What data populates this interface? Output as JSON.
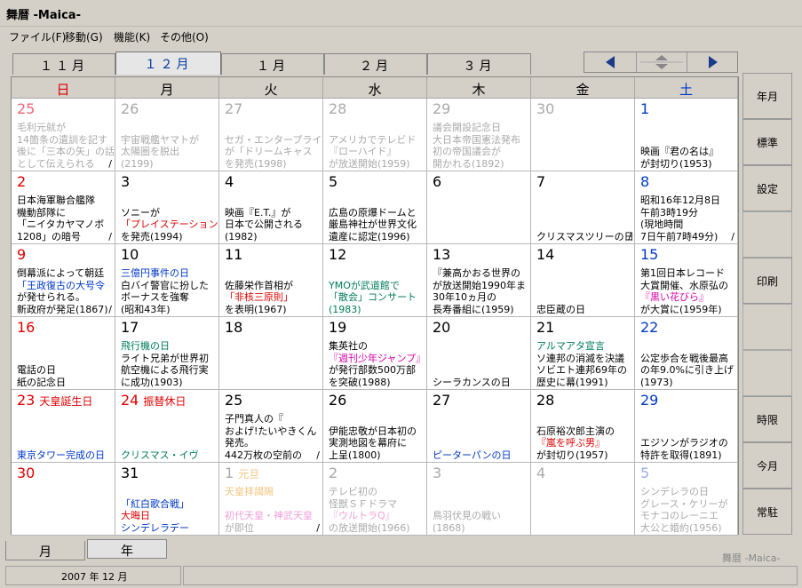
{
  "window": {
    "title": "舞暦 -Maica-",
    "brand": "舞暦 -Maica-"
  },
  "menu": [
    "ファイル(F)",
    "移動(G)",
    "機能(K)",
    "その他(O)"
  ],
  "month_tabs": [
    {
      "label": "１１月",
      "active": false
    },
    {
      "label": "１２月",
      "active": true
    },
    {
      "label": "１月",
      "active": false
    },
    {
      "label": "２月",
      "active": false
    },
    {
      "label": "３月",
      "active": false
    }
  ],
  "nav": {
    "prev": "◀",
    "updown": "⇕",
    "next": "▶"
  },
  "weekdays": [
    {
      "label": "日",
      "color": "#e00000"
    },
    {
      "label": "月",
      "color": "#000000"
    },
    {
      "label": "火",
      "color": "#000000"
    },
    {
      "label": "水",
      "color": "#000000"
    },
    {
      "label": "木",
      "color": "#000000"
    },
    {
      "label": "金",
      "color": "#000000"
    },
    {
      "label": "土",
      "color": "#0039c8"
    }
  ],
  "weeks": [
    [
      {
        "day": "25",
        "nc": "pinkred",
        "tone": "grey",
        "lines": [
          {
            "t": "毛利元就が"
          },
          {
            "t": "14箇条の遺訓を記す"
          },
          {
            "t": "後に「三本の矢」の話"
          },
          {
            "t": "として伝えられる"
          }
        ],
        "slash": true
      },
      {
        "day": "26",
        "nc": "grey",
        "tone": "grey",
        "lines": [
          {
            "t": "宇宙戦艦ヤマトが"
          },
          {
            "t": "太陽圏を脱出"
          },
          {
            "t": "(2199)"
          }
        ]
      },
      {
        "day": "27",
        "nc": "grey",
        "tone": "grey",
        "lines": [
          {
            "t": "セガ・エンタープライ"
          },
          {
            "t": "が「ドリームキャス"
          },
          {
            "t": "を発売(1998)"
          }
        ]
      },
      {
        "day": "28",
        "nc": "grey",
        "tone": "grey",
        "lines": [
          {
            "t": "アメリカでテレビド"
          },
          {
            "t": "『ローハイド』"
          },
          {
            "t": "が放送開始(1959)"
          }
        ]
      },
      {
        "day": "29",
        "nc": "grey",
        "tone": "grey",
        "lines": [
          {
            "t": "議会開設記念日"
          },
          {
            "t": "大日本帝国憲法発布"
          },
          {
            "t": "初の帝国議会が"
          },
          {
            "t": "開かれる(1892)"
          }
        ]
      },
      {
        "day": "30",
        "nc": "grey",
        "tone": "grey",
        "lines": []
      },
      {
        "day": "1",
        "nc": "blue",
        "lines": [
          {
            "t": "映画『君の名は』"
          },
          {
            "t": "が封切り(1953)"
          }
        ]
      }
    ],
    [
      {
        "day": "2",
        "nc": "red",
        "lines": [
          {
            "t": "日本海軍聯合艦隊"
          },
          {
            "t": "機動部隊に"
          },
          {
            "t": "「ニイタカヤマノボ"
          },
          {
            "t": "1208」の暗号"
          }
        ],
        "slash": true
      },
      {
        "day": "3",
        "lines": [
          {
            "t": "ソニーが"
          },
          {
            "t": "「プレイステーション",
            "c": "red"
          },
          {
            "t": "を発売(1994)"
          }
        ]
      },
      {
        "day": "4",
        "lines": [
          {
            "t": "映画『E.T.』が"
          },
          {
            "t": "日本で公開される"
          },
          {
            "t": "(1982)"
          }
        ]
      },
      {
        "day": "5",
        "lines": [
          {
            "t": "広島の原爆ドームと"
          },
          {
            "t": "厳島神社が世界文化"
          },
          {
            "t": "遺産に認定(1996)"
          }
        ]
      },
      {
        "day": "6",
        "lines": []
      },
      {
        "day": "7",
        "lines": [
          {
            "t": "クリスマスツリーの日"
          }
        ],
        "slash": true
      },
      {
        "day": "8",
        "nc": "blue",
        "lines": [
          {
            "t": "昭和16年12月8日"
          },
          {
            "t": "午前3時19分"
          },
          {
            "t": "(現地時間"
          },
          {
            "t": "7日午前7時49分)"
          }
        ],
        "slash": true
      }
    ],
    [
      {
        "day": "9",
        "nc": "red",
        "lines": [
          {
            "t": "倒幕派によって朝廷"
          },
          {
            "t": "「王政復古の大号令",
            "c": "blue"
          },
          {
            "t": "が発せられる。"
          },
          {
            "t": "新政府が発足(1867)"
          }
        ],
        "slash": true
      },
      {
        "day": "10",
        "lines": [
          {
            "t": "三億円事件の日",
            "c": "blue"
          },
          {
            "t": "白バイ警官に扮した"
          },
          {
            "t": "ボーナスを強奪"
          },
          {
            "t": "(昭和43年)"
          }
        ]
      },
      {
        "day": "11",
        "lines": [
          {
            "t": "佐藤栄作首相が"
          },
          {
            "t": "「非核三原則」",
            "c": "red"
          },
          {
            "t": "を表明(1967)"
          }
        ]
      },
      {
        "day": "12",
        "lines": [
          {
            "t": "YMOが武道館で",
            "c": "green"
          },
          {
            "t": "「散会」コンサート",
            "c": "green"
          },
          {
            "t": "(1983)",
            "c": "green"
          }
        ]
      },
      {
        "day": "13",
        "lines": [
          {
            "t": "『兼高かおる世界の"
          },
          {
            "t": "が放送開始1990年ま"
          },
          {
            "t": "30年10ヵ月の"
          },
          {
            "t": "長寿番組に(1959)"
          }
        ]
      },
      {
        "day": "14",
        "lines": [
          {
            "t": "忠臣蔵の日"
          }
        ]
      },
      {
        "day": "15",
        "nc": "blue",
        "lines": [
          {
            "t": "第1回日本レコード"
          },
          {
            "t": "大賞開催、水原弘の"
          },
          {
            "t": "『黒い花びら』",
            "c": "mag"
          },
          {
            "t": "が大賞に(1959年)"
          }
        ]
      }
    ],
    [
      {
        "day": "16",
        "nc": "red",
        "lines": [
          {
            "t": "電話の日"
          },
          {
            "t": "紙の記念日"
          }
        ]
      },
      {
        "day": "17",
        "lines": [
          {
            "t": "飛行機の日",
            "c": "green"
          },
          {
            "t": "ライト兄弟が世界初"
          },
          {
            "t": "航空機による飛行実"
          },
          {
            "t": "に成功(1903)"
          }
        ]
      },
      {
        "day": "18",
        "lines": []
      },
      {
        "day": "19",
        "lines": [
          {
            "t": "集英社の"
          },
          {
            "t": "『週刊少年ジャンプ』",
            "c": "mag"
          },
          {
            "t": "が発行部数500万部"
          },
          {
            "t": "を突破(1988)"
          }
        ]
      },
      {
        "day": "20",
        "lines": [
          {
            "t": "シーラカンスの日"
          }
        ]
      },
      {
        "day": "21",
        "lines": [
          {
            "t": "アルマアタ宣言",
            "c": "green"
          },
          {
            "t": "ソ連邦の消滅を決議"
          },
          {
            "t": "ソビエト連邦69年の"
          },
          {
            "t": "歴史に幕(1991)"
          }
        ]
      },
      {
        "day": "22",
        "nc": "blue",
        "lines": [
          {
            "t": "公定歩合を戦後最高"
          },
          {
            "t": "の年9.0%に引き上げ"
          },
          {
            "t": "(1973)"
          }
        ]
      }
    ],
    [
      {
        "day": "23",
        "nc": "red",
        "tag": "天皇誕生日",
        "lines": [
          {
            "t": "東京タワー完成の日",
            "c": "blue"
          }
        ]
      },
      {
        "day": "24",
        "nc": "red",
        "tag": "振替休日",
        "lines": [
          {
            "t": "クリスマス・イヴ",
            "c": "green"
          }
        ]
      },
      {
        "day": "25",
        "lines": [
          {
            "t": "子門真人の『"
          },
          {
            "t": "およげ!たいやきくん"
          },
          {
            "t": "発売。"
          },
          {
            "t": "442万枚の空前の"
          }
        ],
        "slash": true
      },
      {
        "day": "26",
        "lines": [
          {
            "t": "伊能忠敬が日本初の"
          },
          {
            "t": "実測地図を幕府に"
          },
          {
            "t": "上呈(1800)"
          }
        ]
      },
      {
        "day": "27",
        "lines": [
          {
            "t": "ピーターパンの日",
            "c": "blue"
          }
        ]
      },
      {
        "day": "28",
        "lines": [
          {
            "t": "石原裕次郎主演の"
          },
          {
            "t": "『嵐を呼ぶ男』",
            "c": "red"
          },
          {
            "t": "が封切り(1957)"
          }
        ]
      },
      {
        "day": "29",
        "nc": "blue",
        "lines": [
          {
            "t": "エジソンがラジオの"
          },
          {
            "t": "特許を取得(1891)"
          }
        ]
      }
    ],
    [
      {
        "day": "30",
        "nc": "red",
        "lines": []
      },
      {
        "day": "31",
        "lines": [
          {
            "t": "「紅白歌合戦」",
            "c": "blue"
          },
          {
            "t": "大晦日",
            "c": "red"
          },
          {
            "t": "シンデレラデー",
            "c": "blue"
          }
        ]
      },
      {
        "day": "1",
        "nc": "grey",
        "tag": "元旦",
        "tagc": "#f3c580",
        "tone": "grey",
        "lines": [
          {
            "t": "天皇拝謁賜",
            "c": "peach"
          },
          {
            "t": ""
          },
          {
            "t": "初代天皇・神武天皇",
            "c": "pinkl"
          },
          {
            "t": "が即位"
          }
        ],
        "slash": true
      },
      {
        "day": "2",
        "nc": "grey",
        "tone": "grey",
        "lines": [
          {
            "t": "テレビ初の"
          },
          {
            "t": "怪獣ＳＦドラマ"
          },
          {
            "t": "『ウルトラQ』",
            "c": "pinkl"
          },
          {
            "t": "の放送開始(1966)"
          }
        ]
      },
      {
        "day": "3",
        "nc": "grey",
        "tone": "grey",
        "lines": [
          {
            "t": "鳥羽伏見の戦い"
          },
          {
            "t": "(1868)"
          }
        ]
      },
      {
        "day": "4",
        "nc": "grey",
        "tone": "grey",
        "lines": []
      },
      {
        "day": "5",
        "nc": "lightblue",
        "tone": "grey",
        "lines": [
          {
            "t": "シンデレラの日"
          },
          {
            "t": "グレース・ケリーが"
          },
          {
            "t": "モナコのレーニエ"
          },
          {
            "t": "大公と婚約(1956)"
          }
        ]
      }
    ]
  ],
  "sidebar": {
    "nengetsu": "年月",
    "hyojun": "標準",
    "settei": "設定",
    "insatsu": "印刷",
    "jigen": "時限",
    "kongetsu": "今月",
    "jochu": "常駐"
  },
  "bottom_tabs": {
    "month": "月",
    "year": "年"
  },
  "status": {
    "date": "2007 年 12 月"
  }
}
